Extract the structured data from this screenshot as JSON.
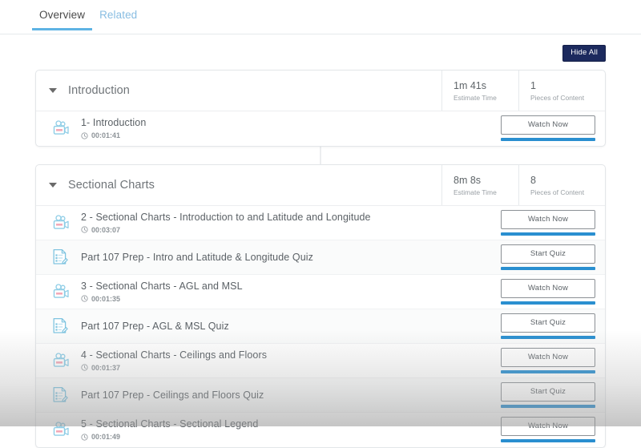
{
  "tabs": [
    {
      "label": "Overview",
      "active": true
    },
    {
      "label": "Related",
      "active": false
    }
  ],
  "toolbar": {
    "hide_all_label": "Hide All",
    "hide_all_bg": "#1c2a5e"
  },
  "meta_labels": {
    "estimate_time": "Estimate Time",
    "pieces_of_content": "Pieces of Content"
  },
  "accent": {
    "tab_underline": "#5eb3e4",
    "progress_bar": "#2a8fd0",
    "video_icon": "#8ecde6",
    "video_icon_accent": "#e8788f",
    "quiz_icon": "#7fc4e0"
  },
  "sections": [
    {
      "title": "Introduction",
      "estimate_time": "1m 41s",
      "pieces_of_content": "1",
      "rows": [
        {
          "icon": "video-camera-icon",
          "title": "1- Introduction",
          "duration": "00:01:41",
          "action_label": "Watch Now",
          "progress": 100
        }
      ]
    },
    {
      "title": "Sectional Charts",
      "estimate_time": "8m 8s",
      "pieces_of_content": "8",
      "rows": [
        {
          "icon": "video-camera-icon",
          "title": "2 - Sectional Charts - Introduction to and Latitude and Longitude",
          "duration": "00:03:07",
          "action_label": "Watch Now",
          "progress": 100
        },
        {
          "icon": "quiz-document-icon",
          "title": "Part 107 Prep - Intro and Latitude & Longitude Quiz",
          "duration": "",
          "action_label": "Start Quiz",
          "progress": 100
        },
        {
          "icon": "video-camera-icon",
          "title": "3 - Sectional Charts - AGL and MSL",
          "duration": "00:01:35",
          "action_label": "Watch Now",
          "progress": 100
        },
        {
          "icon": "quiz-document-icon",
          "title": "Part 107 Prep - AGL & MSL Quiz",
          "duration": "",
          "action_label": "Start Quiz",
          "progress": 100
        },
        {
          "icon": "video-camera-icon",
          "title": "4 - Sectional Charts - Ceilings and Floors",
          "duration": "00:01:37",
          "action_label": "Watch Now",
          "progress": 100
        },
        {
          "icon": "quiz-document-icon",
          "title": "Part 107 Prep - Ceilings and Floors Quiz",
          "duration": "",
          "action_label": "Start Quiz",
          "progress": 100
        },
        {
          "icon": "video-camera-icon",
          "title": "5 - Sectional Charts - Sectional Legend",
          "duration": "00:01:49",
          "action_label": "Watch Now",
          "progress": 100
        }
      ]
    }
  ]
}
